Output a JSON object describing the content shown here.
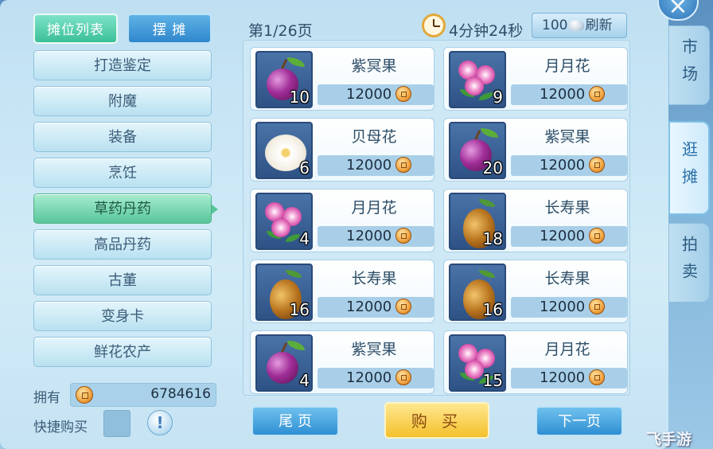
{
  "tabs": {
    "stall_list": "摊位列表",
    "set_stall": "摆 摊"
  },
  "categories": [
    {
      "label": "打造鉴定",
      "selected": false
    },
    {
      "label": "附魔",
      "selected": false
    },
    {
      "label": "装备",
      "selected": false
    },
    {
      "label": "烹饪",
      "selected": false
    },
    {
      "label": "草药丹药",
      "selected": true
    },
    {
      "label": "高品丹药",
      "selected": false
    },
    {
      "label": "古董",
      "selected": false
    },
    {
      "label": "变身卡",
      "selected": false
    },
    {
      "label": "鲜花农产",
      "selected": false
    }
  ],
  "own": {
    "label": "拥有",
    "value": "6784616"
  },
  "quick_buy": {
    "label": "快捷购买",
    "info": "!"
  },
  "header": {
    "page": "第1/26页",
    "timer": "4分钟24秒",
    "refresh_cost": "100",
    "refresh_label": "刷新"
  },
  "items": [
    {
      "name": "紫冥果",
      "price": "12000",
      "qty": "10",
      "art": "plum"
    },
    {
      "name": "月月花",
      "price": "12000",
      "qty": "9",
      "art": "flower"
    },
    {
      "name": "贝母花",
      "price": "12000",
      "qty": "6",
      "art": "white"
    },
    {
      "name": "紫冥果",
      "price": "12000",
      "qty": "20",
      "art": "plum"
    },
    {
      "name": "月月花",
      "price": "12000",
      "qty": "4",
      "art": "flower"
    },
    {
      "name": "长寿果",
      "price": "12000",
      "qty": "18",
      "art": "gourd"
    },
    {
      "name": "长寿果",
      "price": "12000",
      "qty": "16",
      "art": "gourd"
    },
    {
      "name": "长寿果",
      "price": "12000",
      "qty": "16",
      "art": "gourd"
    },
    {
      "name": "紫冥果",
      "price": "12000",
      "qty": "4",
      "art": "plum"
    },
    {
      "name": "月月花",
      "price": "12000",
      "qty": "15",
      "art": "flower"
    }
  ],
  "buttons": {
    "last_page": "尾 页",
    "buy": "购 买",
    "next_page": "下一页"
  },
  "side_tabs": [
    {
      "label": "市场",
      "active": false
    },
    {
      "label": "逛摊",
      "active": true
    },
    {
      "label": "拍卖",
      "active": false
    }
  ],
  "close": "×",
  "watermark": "飞手游"
}
